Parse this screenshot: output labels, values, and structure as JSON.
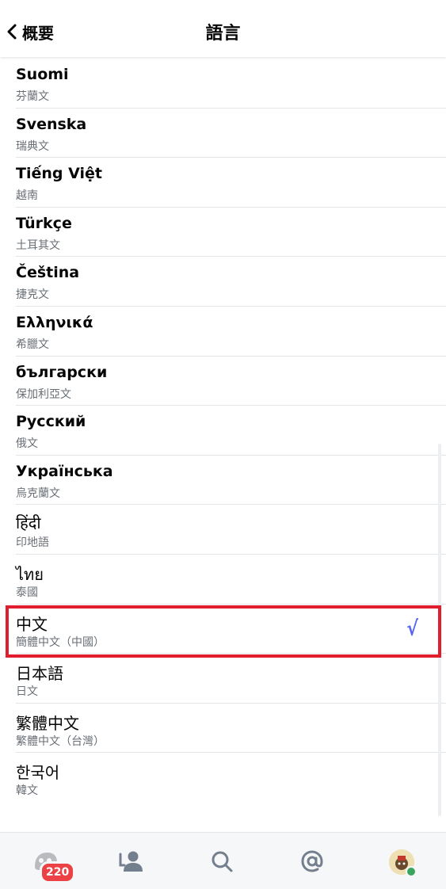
{
  "header": {
    "back_label": "概要",
    "title": "語言"
  },
  "languages": [
    {
      "native": "Suomi",
      "translated": "芬蘭文",
      "selected": false
    },
    {
      "native": "Svenska",
      "translated": "瑞典文",
      "selected": false
    },
    {
      "native": "Tiếng Việt",
      "translated": "越南",
      "selected": false
    },
    {
      "native": "Türkçe",
      "translated": "土耳其文",
      "selected": false
    },
    {
      "native": "Čeština",
      "translated": "捷克文",
      "selected": false
    },
    {
      "native": "Ελληνικά",
      "translated": "希臘文",
      "selected": false
    },
    {
      "native": "български",
      "translated": "保加利亞文",
      "selected": false
    },
    {
      "native": "Русский",
      "translated": "俄文",
      "selected": false
    },
    {
      "native": "Українська",
      "translated": "烏克蘭文",
      "selected": false
    },
    {
      "native": "हिंदी",
      "translated": "印地語",
      "selected": false
    },
    {
      "native": "ไทย",
      "translated": "泰國",
      "selected": false
    },
    {
      "native": "中文",
      "translated": "簡體中文（中國）",
      "selected": true
    },
    {
      "native": "日本語",
      "translated": "日文",
      "selected": false
    },
    {
      "native": "繁體中文",
      "translated": "繁體中文（台灣）",
      "selected": false
    },
    {
      "native": "한국어",
      "translated": "韓文",
      "selected": false
    }
  ],
  "selected_mark": "√",
  "tabbar": {
    "unread_badge": "220",
    "icons": [
      "servers-icon",
      "friends-icon",
      "search-icon",
      "mentions-icon",
      "profile-avatar"
    ]
  },
  "colors": {
    "accent": "#5865f2",
    "highlight": "#e01e2e",
    "badge": "#ed4245",
    "online": "#3ba55d"
  }
}
